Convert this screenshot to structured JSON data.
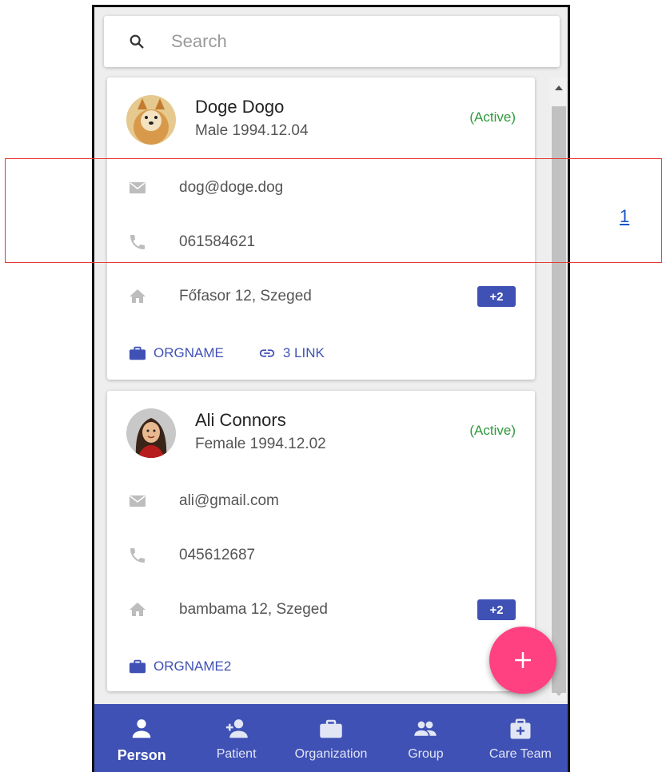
{
  "search": {
    "placeholder": "Search",
    "icon": "search-icon"
  },
  "persons": [
    {
      "name": "Doge Dogo",
      "gender_birth": "Male 1994.12.04",
      "status": "(Active)",
      "email": "dog@doge.dog",
      "phone": "061584621",
      "address": "Főfasor 12, Szeged",
      "address_more": "+2",
      "org": "ORGNAME",
      "links": "3 LINK"
    },
    {
      "name": "Ali Connors",
      "gender_birth": "Female 1994.12.02",
      "status": "(Active)",
      "email": "ali@gmail.com",
      "phone": "045612687",
      "address": "bambama 12, Szeged",
      "address_more": "+2",
      "org": "ORGNAME2"
    }
  ],
  "nav": [
    {
      "label": "Person",
      "icon": "person-icon",
      "active": true
    },
    {
      "label": "Patient",
      "icon": "person-add-icon"
    },
    {
      "label": "Organization",
      "icon": "briefcase-icon"
    },
    {
      "label": "Group",
      "icon": "group-icon"
    },
    {
      "label": "Care Team",
      "icon": "medical-bag-icon"
    }
  ],
  "annotation": {
    "label": "1"
  },
  "colors": {
    "primary": "#3f51b5",
    "accent": "#ff4081",
    "active_status": "#2e9a3b",
    "highlight": "#e53935"
  }
}
